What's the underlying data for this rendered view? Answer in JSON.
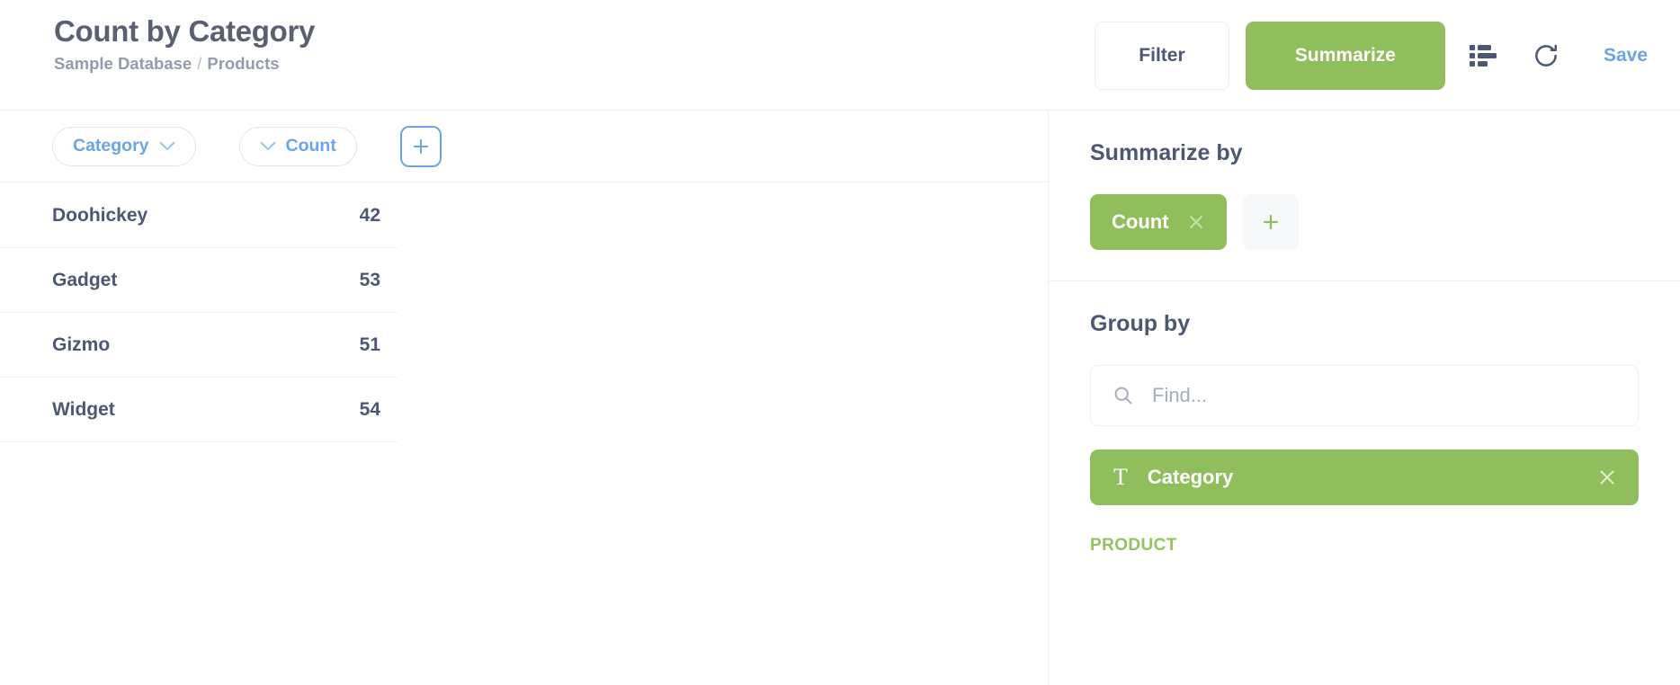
{
  "header": {
    "title": "Count by Category",
    "breadcrumb": {
      "database": "Sample Database",
      "separator": "/",
      "table": "Products"
    },
    "filter_label": "Filter",
    "summarize_label": "Summarize",
    "visualization_icon": "bar-chart-icon",
    "refresh_icon": "refresh-icon",
    "save_label": "Save"
  },
  "query_bar": {
    "chips": [
      {
        "label": "Category",
        "chevron": "chevron-down-icon",
        "chevron_side": "right"
      },
      {
        "label": "Count",
        "chevron": "chevron-down-icon",
        "chevron_side": "left"
      }
    ],
    "add_label": "+"
  },
  "table": {
    "columns": [
      "Category",
      "Count"
    ],
    "rows": [
      {
        "category": "Doohickey",
        "count": "42"
      },
      {
        "category": "Gadget",
        "count": "53"
      },
      {
        "category": "Gizmo",
        "count": "51"
      },
      {
        "category": "Widget",
        "count": "54"
      }
    ]
  },
  "sidebar": {
    "summarize": {
      "heading": "Summarize by",
      "aggregation": "Count",
      "remove_icon": "close-icon",
      "add_label": "+"
    },
    "group_by": {
      "heading": "Group by",
      "search_placeholder": "Find...",
      "search_value": "",
      "search_icon": "search-icon",
      "selected_field": {
        "type_icon": "T",
        "label": "Category",
        "remove_icon": "close-icon"
      },
      "group_label": "PRODUCT"
    }
  },
  "colors": {
    "brand_green": "#91BE5D",
    "link_blue": "#6BA5E3",
    "text_primary": "#4C5773",
    "text_muted": "#949BAB",
    "group_label_green": "#94C25F",
    "border": "#EDF0F1"
  },
  "chart_data": {
    "type": "table",
    "title": "Count by Category",
    "categories": [
      "Doohickey",
      "Gadget",
      "Gizmo",
      "Widget"
    ],
    "values": [
      42,
      53,
      51,
      54
    ],
    "xlabel": "Category",
    "ylabel": "Count"
  }
}
